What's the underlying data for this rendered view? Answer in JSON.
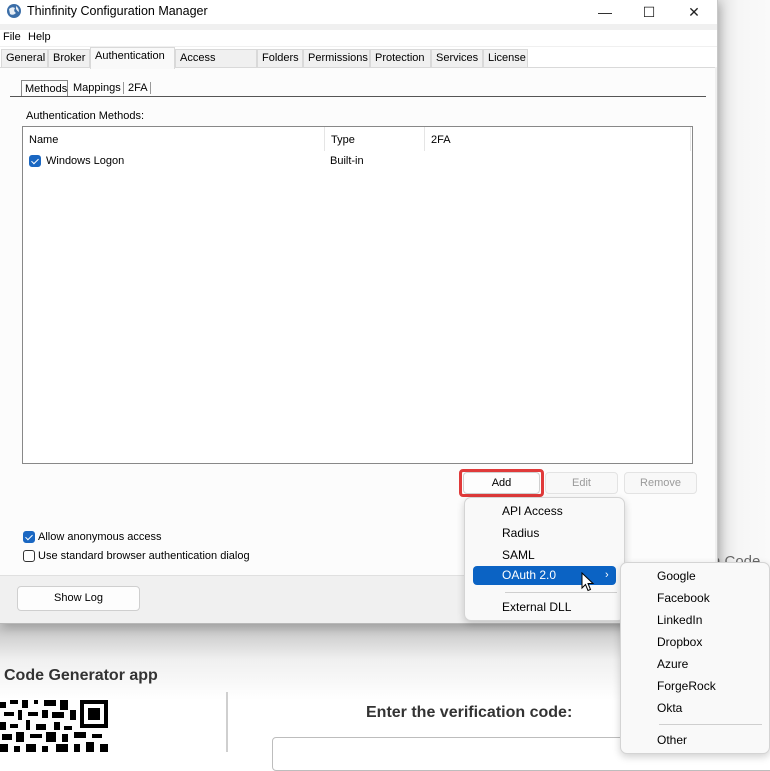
{
  "background_page": {
    "code_peek_text": "n Code",
    "heading": "Code Generator app",
    "verify_label": "Enter the verification code:",
    "verify_input_value": ""
  },
  "window": {
    "title": "Thinfinity Configuration Manager",
    "icon": "thinfinity-globe-icon",
    "controls": {
      "minimize": "—",
      "maximize": "☐",
      "close": "✕"
    },
    "menubar": [
      "File",
      "Help"
    ],
    "tabs": [
      {
        "label": "General",
        "active": false
      },
      {
        "label": "Broker",
        "active": false
      },
      {
        "label": "Authentication",
        "active": true
      },
      {
        "label": "Access Profiles",
        "active": false
      },
      {
        "label": "Folders",
        "active": false
      },
      {
        "label": "Permissions",
        "active": false
      },
      {
        "label": "Protection",
        "active": false
      },
      {
        "label": "Services",
        "active": false
      },
      {
        "label": "License",
        "active": false
      }
    ],
    "subtabs": [
      {
        "label": "Methods",
        "active": true
      },
      {
        "label": "Mappings",
        "active": false
      },
      {
        "label": "2FA",
        "active": false
      }
    ],
    "methods_label": "Authentication Methods:",
    "columns": [
      "Name",
      "Type",
      "2FA"
    ],
    "rows": [
      {
        "checked": true,
        "name": "Windows Logon",
        "type": "Built-in",
        "twofa": ""
      }
    ],
    "buttons": {
      "add": "Add",
      "edit": "Edit",
      "remove": "Remove",
      "show_log": "Show Log"
    },
    "options": [
      {
        "label": "Allow anonymous access",
        "checked": true
      },
      {
        "label": "Use standard browser authentication dialog",
        "checked": false
      }
    ]
  },
  "add_menu": {
    "items": [
      "API Access",
      "Radius",
      "SAML",
      "OAuth 2.0",
      "External DLL"
    ],
    "highlighted": "OAuth 2.0",
    "submenu_arrow": "›"
  },
  "oauth_submenu": {
    "items": [
      "Google",
      "Facebook",
      "LinkedIn",
      "Dropbox",
      "Azure",
      "ForgeRock",
      "Okta",
      "Other"
    ]
  },
  "colors": {
    "accent": "#0b63c4",
    "highlight_box": "#e03a3a",
    "checkbox": "#1a67c2"
  }
}
